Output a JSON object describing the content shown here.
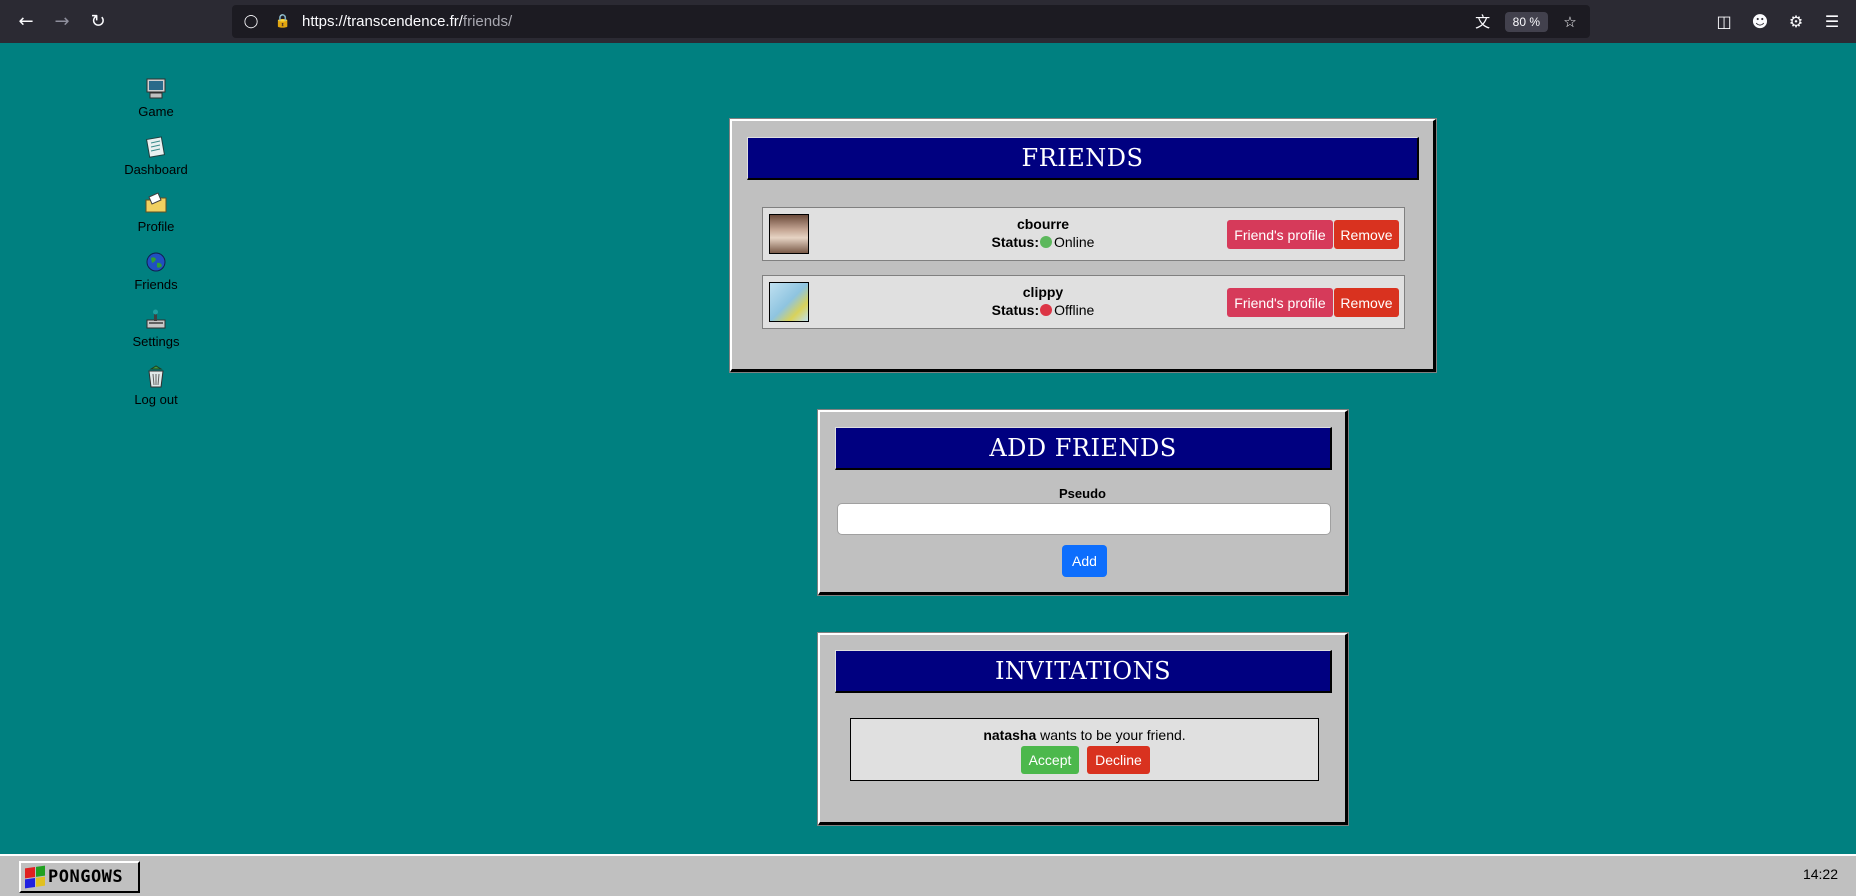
{
  "browser": {
    "url_host": "https://transcendence.fr/",
    "url_path": "friends/",
    "zoom": "80 %"
  },
  "desktop": {
    "items": [
      {
        "label": "Game",
        "icon": "computer-icon"
      },
      {
        "label": "Dashboard",
        "icon": "notepad-icon"
      },
      {
        "label": "Profile",
        "icon": "folder-icon"
      },
      {
        "label": "Friends",
        "icon": "globe-icon"
      },
      {
        "label": "Settings",
        "icon": "settings-icon"
      },
      {
        "label": "Log out",
        "icon": "recycle-bin-icon"
      }
    ]
  },
  "friends": {
    "title": "FRIENDS",
    "list": [
      {
        "name": "cbourre",
        "status_label": "Status:",
        "status": "Online",
        "status_color": "#5cb85c",
        "profile_label": "Friend's profile",
        "remove_label": "Remove"
      },
      {
        "name": "clippy",
        "status_label": "Status:",
        "status": "Offline",
        "status_color": "#dc3545",
        "profile_label": "Friend's profile",
        "remove_label": "Remove"
      }
    ]
  },
  "add_friends": {
    "title": "ADD FRIENDS",
    "field_label": "Pseudo",
    "field_value": "",
    "button_label": "Add"
  },
  "invitations": {
    "title": "INVITATIONS",
    "items": [
      {
        "name": "natasha",
        "message": " wants to be your friend.",
        "accept_label": "Accept",
        "decline_label": "Decline"
      }
    ]
  },
  "taskbar": {
    "start_label": "PONGOWS",
    "clock": "14:22"
  },
  "colors": {
    "desktop_bg": "#008080",
    "title_bar": "#000080",
    "window_bg": "#c0c0c0"
  }
}
